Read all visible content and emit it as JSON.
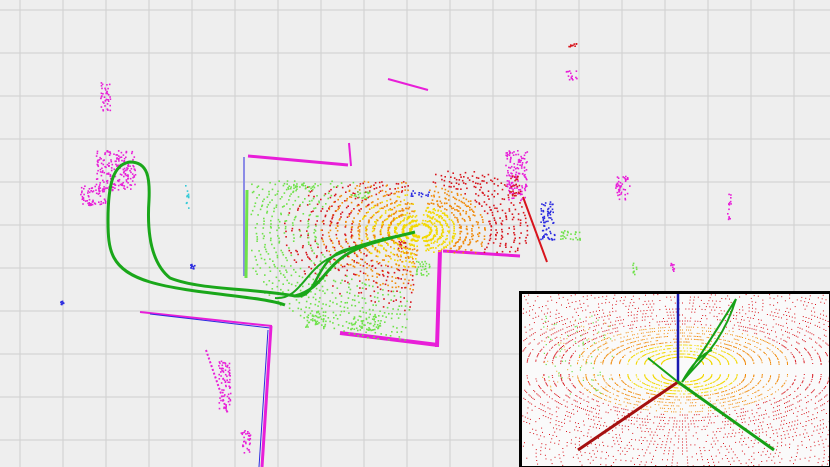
{
  "viewer": {
    "mode": "3d-pointcloud-view",
    "background_color": "#eeeeee",
    "grid_color": "#cfcfcf",
    "trajectory_color": "#1aa71a",
    "inset_border_color": "#000000"
  },
  "pointcloud_palette": {
    "magenta": "#e81ed8",
    "red": "#d8141c",
    "orange": "#f08a0a",
    "yellow": "#f2d800",
    "green": "#6fe24a",
    "blue": "#2a2ae0",
    "cyan": "#31c9d6"
  },
  "axes": {
    "x_color": "#a51010",
    "y_color": "#16a016",
    "z_color": "#1a1ab0"
  },
  "icons": [
    "axis-gizmo-icon"
  ]
}
